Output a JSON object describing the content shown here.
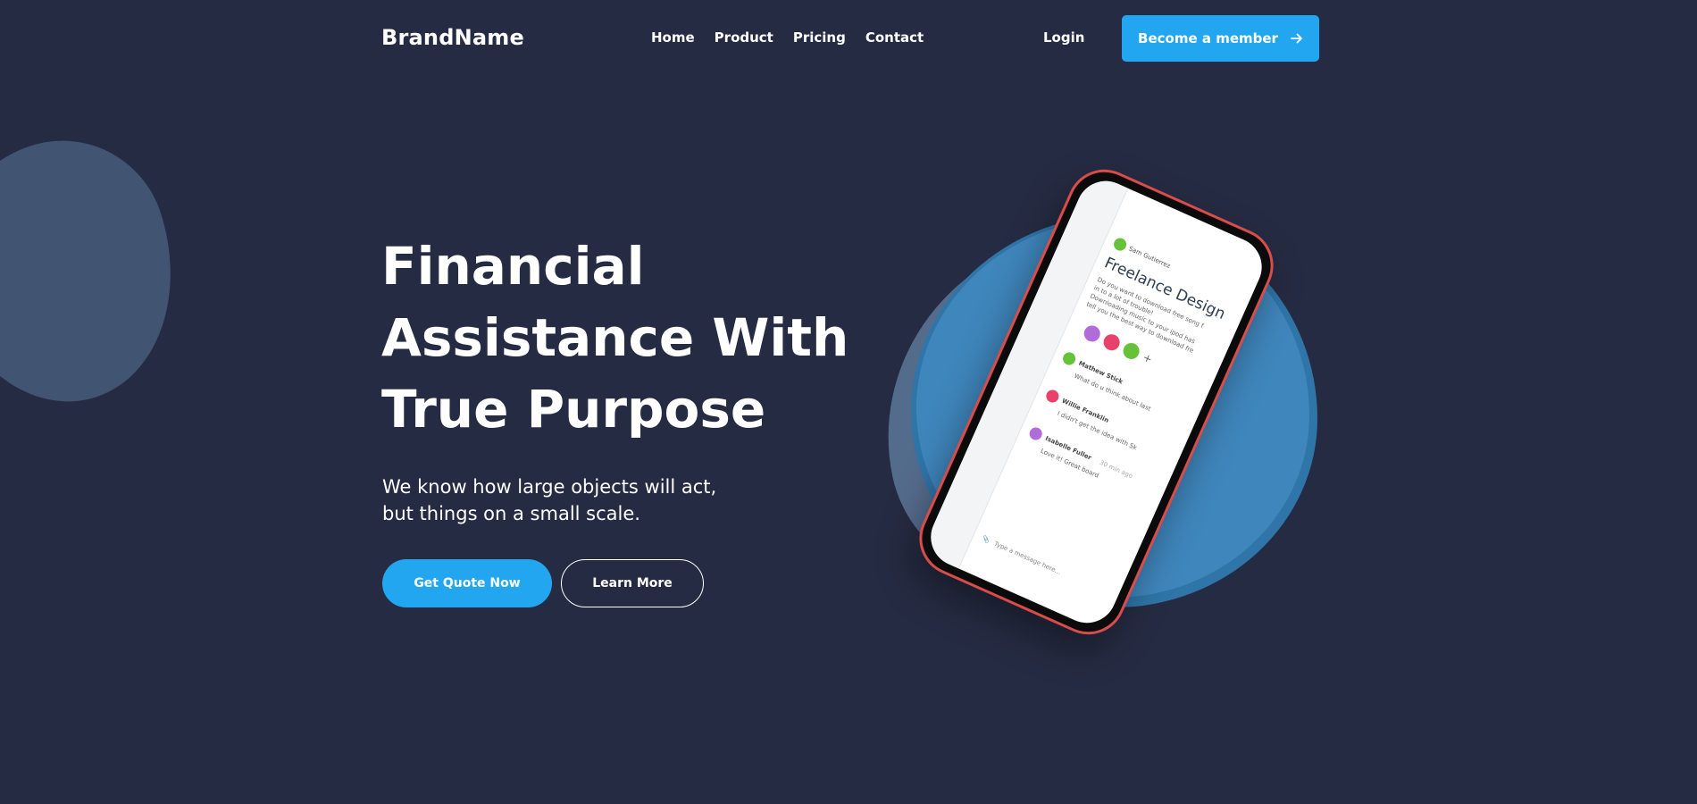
{
  "nav": {
    "brand": "BrandName",
    "links": [
      "Home",
      "Product",
      "Pricing",
      "Contact"
    ],
    "login": "Login",
    "cta": "Become a member",
    "cta_icon": "arrow-right-icon"
  },
  "hero": {
    "title_lines": [
      "Financial",
      "Assistance With",
      "True Purpose"
    ],
    "subtitle_lines": [
      "We know how large objects will act,",
      "but things on a small scale."
    ],
    "primary_button": "Get Quote Now",
    "secondary_button": "Learn More"
  },
  "phone_screen": {
    "author": "Sam Gutierrez",
    "title": "Freelance Design",
    "body_lines": [
      "Do you want to download free song f",
      "in to a lot of trouble!",
      "Downloading music to your ipod has",
      "tell you the best way to download fre"
    ],
    "messages": [
      {
        "name": "Mathew Stick",
        "text": "What do u think about last",
        "avatar": "green"
      },
      {
        "name": "Willie Franklin",
        "text": "I didn't get the idea with Sk",
        "avatar": "pink"
      },
      {
        "name": "Isabelle Fuller",
        "text": "Love it! Great board",
        "time": "30 min ago",
        "avatar": "purple"
      }
    ],
    "input_placeholder": "Type a message here..."
  },
  "colors": {
    "background": "#252b42",
    "accent": "#23a6f0",
    "blob": "#415472",
    "phone_frame": "#d94c4c"
  }
}
